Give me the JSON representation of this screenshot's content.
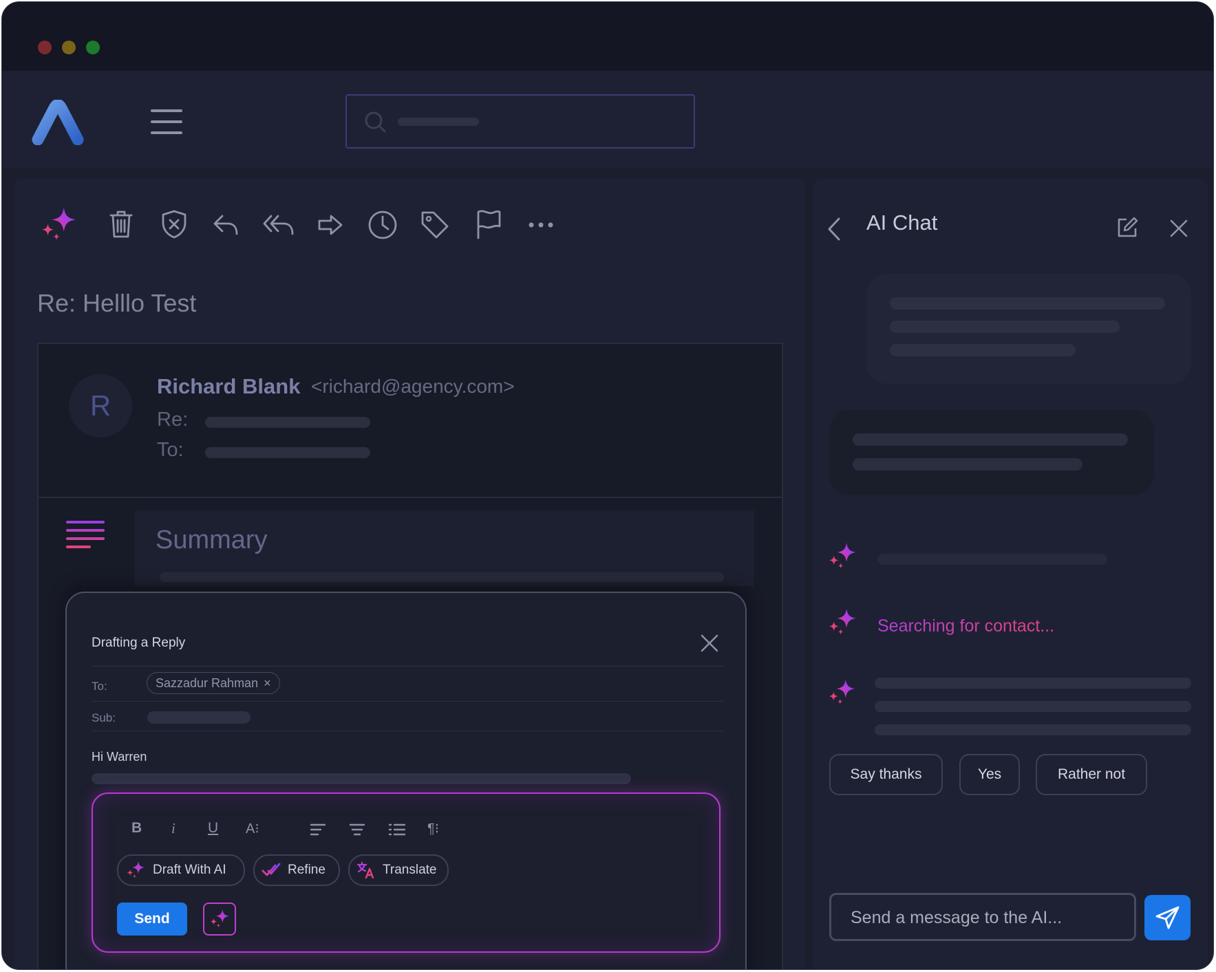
{
  "toolbar": {
    "icons": [
      "ai-sparkle-icon",
      "trash-icon",
      "shield-x-icon",
      "reply-icon",
      "reply-all-icon",
      "forward-icon",
      "clock-icon",
      "tag-icon",
      "flag-icon",
      "more-icon"
    ]
  },
  "email": {
    "subject": "Re: Helllo Test",
    "avatar_initial": "R",
    "sender_name": "Richard Blank",
    "sender_email": "<richard@agency.com>",
    "re_label": "Re:",
    "to_label": "To:"
  },
  "summary": {
    "title": "Summary"
  },
  "draft": {
    "title": "Drafting a Reply",
    "to_label": "To:",
    "recipient": "Sazzadur Rahman",
    "recipient_remove": "×",
    "sub_label": "Sub:",
    "greeting": "Hi Warren",
    "format_buttons": [
      "B",
      "i",
      "U",
      "A⁝",
      "align-left",
      "align-center",
      "list",
      "¶⁝"
    ],
    "draft_ai_label": "Draft With AI",
    "refine_label": "Refine",
    "translate_label": "Translate",
    "send_label": "Send"
  },
  "chat": {
    "title": "AI Chat",
    "status": "Searching for contact...",
    "suggestions": [
      "Say thanks",
      "Yes",
      "Rather not"
    ],
    "input_placeholder": "Send a message to the AI..."
  },
  "colors": {
    "window_bg": "#1b1e2c",
    "accent_blue": "#1b76e8",
    "ai_gradient_start": "#8b3ff0",
    "ai_gradient_end": "#e2437b"
  }
}
